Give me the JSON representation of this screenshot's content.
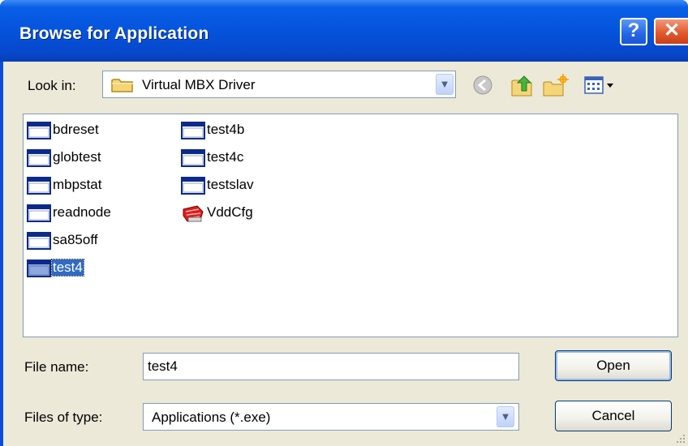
{
  "window": {
    "title": "Browse for Application",
    "help_label": "?",
    "close_label": "✕"
  },
  "look_in": {
    "label": "Look in:",
    "value": "Virtual MBX Driver"
  },
  "files": [
    {
      "name": "bdreset",
      "icon": "application-window-icon"
    },
    {
      "name": "globtest",
      "icon": "application-window-icon"
    },
    {
      "name": "mbpstat",
      "icon": "application-window-icon"
    },
    {
      "name": "readnode",
      "icon": "application-window-icon"
    },
    {
      "name": "sa85off",
      "icon": "application-window-icon"
    },
    {
      "name": "test4",
      "icon": "application-window-icon",
      "selected": true
    },
    {
      "name": "test4b",
      "icon": "application-window-icon"
    },
    {
      "name": "test4c",
      "icon": "application-window-icon"
    },
    {
      "name": "testslav",
      "icon": "application-window-icon"
    },
    {
      "name": "VddCfg",
      "icon": "vddcfg-app-icon"
    }
  ],
  "file_name": {
    "label": "File name:",
    "value": "test4"
  },
  "file_type": {
    "label": "Files of type:",
    "value": "Applications (*.exe)"
  },
  "buttons": {
    "open": "Open",
    "cancel": "Cancel"
  },
  "colors": {
    "titlebar": "#0553dd",
    "selection": "#316ac5",
    "dialog_face": "#ece9d8"
  }
}
